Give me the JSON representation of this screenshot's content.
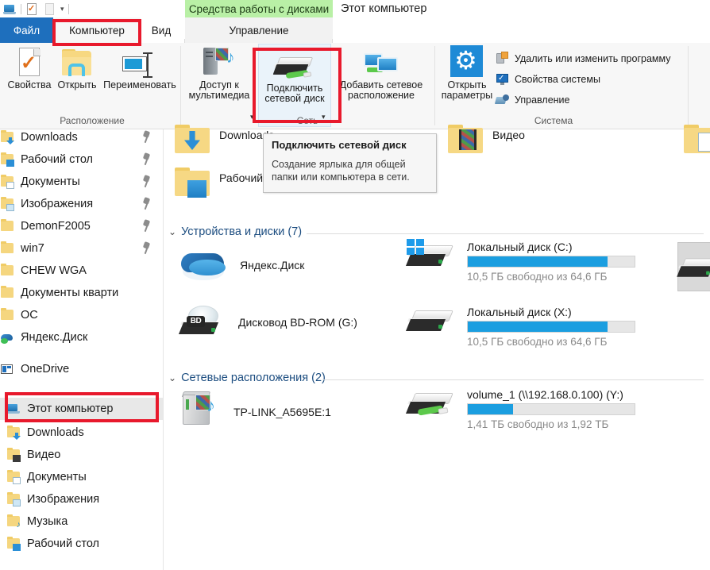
{
  "quick_access": {
    "icons": [
      "computer-icon",
      "properties-check-icon",
      "new-folder-icon",
      "customize-caret-icon"
    ],
    "caret": "▾"
  },
  "window": {
    "contextual_tool_header": "Средства работы с дисками",
    "title": "Этот компьютер"
  },
  "tabs": [
    {
      "label": "Файл",
      "name": "tab-file"
    },
    {
      "label": "Компьютер",
      "name": "tab-computer"
    },
    {
      "label": "Вид",
      "name": "tab-view"
    },
    {
      "label": "Управление",
      "name": "tab-manage"
    }
  ],
  "ribbon": {
    "groups": [
      {
        "label": "Расположение"
      },
      {
        "label": "Сеть"
      },
      {
        "label": "Система"
      }
    ],
    "location_buttons": [
      {
        "label": "Свойства",
        "icon": "properties-icon"
      },
      {
        "label": "Открыть",
        "icon": "open-folder-icon"
      },
      {
        "label": "Переименовать",
        "icon": "rename-icon"
      }
    ],
    "network_buttons": [
      {
        "label_line1": "Доступ к",
        "label_line2": "мультимедиа",
        "icon": "media-streaming-icon",
        "has_caret": true
      },
      {
        "label_line1": "Подключить",
        "label_line2": "сетевой диск",
        "icon": "map-network-drive-icon",
        "has_caret": true
      },
      {
        "label_line1": "Добавить сетевое",
        "label_line2": "расположение",
        "icon": "add-network-location-icon",
        "has_caret": false
      }
    ],
    "system_button": {
      "label_line1": "Открыть",
      "label_line2": "параметры",
      "icon": "settings-gear-icon"
    },
    "system_items": [
      {
        "label": "Удалить или изменить программу",
        "icon": "uninstall-program-icon"
      },
      {
        "label": "Свойства системы",
        "icon": "system-properties-icon"
      },
      {
        "label": "Управление",
        "icon": "computer-management-icon"
      }
    ]
  },
  "tooltip": {
    "title": "Подключить сетевой диск",
    "body": "Создание ярлыка для общей папки или компьютера в сети."
  },
  "sidebar": {
    "quick_access_items": [
      {
        "label": "Downloads",
        "icon": "downloads-folder-icon",
        "pinned": true
      },
      {
        "label": "Рабочий стол",
        "icon": "desktop-folder-icon",
        "pinned": true
      },
      {
        "label": "Документы",
        "icon": "documents-folder-icon",
        "pinned": true
      },
      {
        "label": "Изображения",
        "icon": "pictures-folder-icon",
        "pinned": true
      },
      {
        "label": "DemonF2005",
        "icon": "folder-icon",
        "pinned": true
      },
      {
        "label": "win7",
        "icon": "folder-icon",
        "pinned": true
      },
      {
        "label": "CHEW WGA",
        "icon": "folder-icon",
        "pinned": false
      },
      {
        "label": "Документы кварти",
        "icon": "folder-icon",
        "pinned": false
      },
      {
        "label": "ОС",
        "icon": "folder-icon",
        "pinned": false
      },
      {
        "label": "Яндекс.Диск",
        "icon": "yandex-disk-icon",
        "pinned": false
      }
    ],
    "onedrive": {
      "label": "OneDrive",
      "icon": "onedrive-icon"
    },
    "this_pc": {
      "label": "Этот компьютер",
      "icon": "this-pc-icon",
      "selected": true
    },
    "this_pc_children": [
      {
        "label": "Downloads",
        "icon": "downloads-folder-icon"
      },
      {
        "label": "Видео",
        "icon": "videos-folder-icon"
      },
      {
        "label": "Документы",
        "icon": "documents-folder-icon"
      },
      {
        "label": "Изображения",
        "icon": "pictures-folder-icon"
      },
      {
        "label": "Музыка",
        "icon": "music-folder-icon"
      },
      {
        "label": "Рабочий стол",
        "icon": "desktop-folder-icon"
      }
    ]
  },
  "content": {
    "top_folders": [
      {
        "label": "Downloads",
        "icon": "downloads-folder-icon"
      },
      {
        "label": "Видео",
        "icon": "videos-folder-icon"
      },
      {
        "label": "Рабочий стол",
        "icon": "desktop-folder-icon"
      }
    ],
    "groups": [
      {
        "header": "Устройства и диски (7)",
        "name": "devices-and-drives-group"
      },
      {
        "header": "Сетевые расположения (2)",
        "name": "network-locations-group"
      }
    ],
    "devices": [
      {
        "name_text": "Яндекс.Диск",
        "icon": "yandex-disk-icon",
        "type": "plain"
      },
      {
        "name_text": "Локальный диск (C:)",
        "icon": "windows-drive-icon",
        "type": "drive",
        "free_text": "10,5 ГБ свободно из 64,6 ГБ",
        "used_percent": 84
      },
      {
        "name_text": "Дисковод BD-ROM (G:)",
        "icon": "bd-rom-drive-icon",
        "type": "plain",
        "badge": "BD"
      },
      {
        "name_text": "Локальный диск (X:)",
        "icon": "local-drive-icon",
        "type": "drive",
        "free_text": "10,5 ГБ свободно из 64,6 ГБ",
        "used_percent": 84
      }
    ],
    "network": [
      {
        "name_text": "TP-LINK_A5695E:1",
        "icon": "media-device-icon",
        "type": "plain"
      },
      {
        "name_text": "volume_1 (\\\\192.168.0.100) (Y:)",
        "icon": "network-drive-icon",
        "type": "drive",
        "free_text": "1,41 ТБ свободно из 1,92 ТБ",
        "used_percent": 27
      }
    ]
  },
  "colors": {
    "accent_blue": "#1e6fbd",
    "progress_blue": "#1b9ee0",
    "annotation_red": "#e8192c",
    "contextual_green": "#b9f0a6",
    "group_header_blue": "#1c4d80",
    "muted_text": "#8a8a8a"
  }
}
